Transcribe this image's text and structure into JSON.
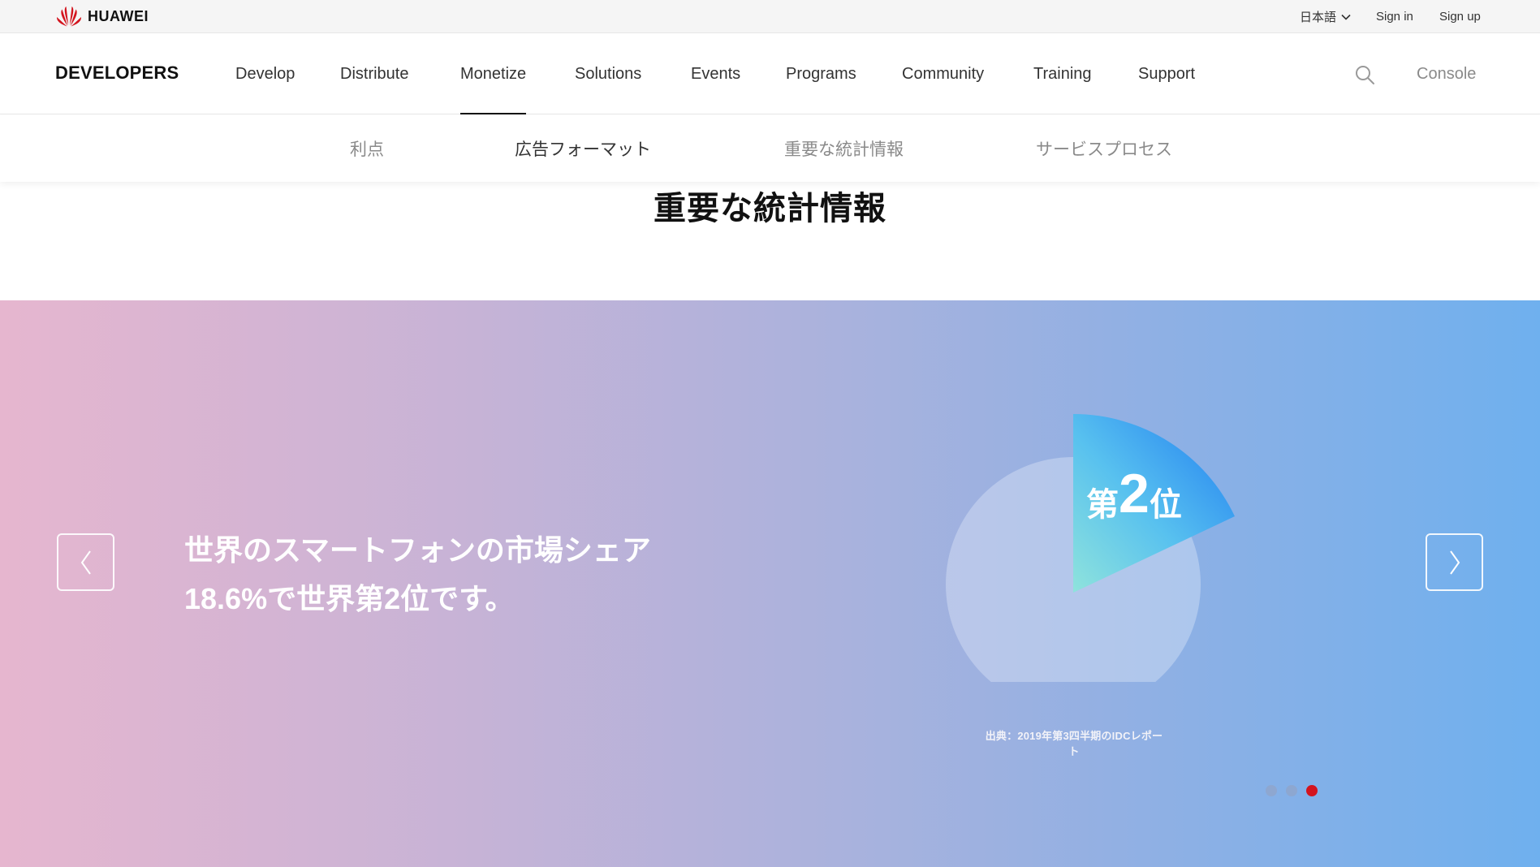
{
  "topbar": {
    "brand": "HUAWEI",
    "language": "日本語",
    "sign_in": "Sign in",
    "sign_up": "Sign up"
  },
  "nav": {
    "logo": "DEVELOPERS",
    "items": [
      {
        "label": "Develop"
      },
      {
        "label": "Distribute"
      },
      {
        "label": "Monetize",
        "active": true
      },
      {
        "label": "Solutions"
      },
      {
        "label": "Events"
      },
      {
        "label": "Programs"
      },
      {
        "label": "Community"
      },
      {
        "label": "Training"
      },
      {
        "label": "Support"
      }
    ],
    "search_icon": "search-icon",
    "console": "Console"
  },
  "subnav": {
    "items": [
      {
        "label": "利点"
      },
      {
        "label": "広告フォーマット",
        "active": true
      },
      {
        "label": "重要な統計情報"
      },
      {
        "label": "サービスプロセス"
      }
    ]
  },
  "section": {
    "title": "重要な統計情報"
  },
  "banner": {
    "headline_line1": "世界のスマートフォンの市場シェア",
    "headline_line2": "18.6%で世界第2位です。",
    "rank_prefix": "第",
    "rank_number": "2",
    "rank_suffix": "位",
    "source": "出典：2019年第3四半期のIDCレポート",
    "dots_total": 3,
    "dots_active_index": 2,
    "colors": {
      "active_dot": "#d3141e",
      "gradient_start": "#e6b6cf",
      "gradient_end": "#6fb0ee"
    }
  }
}
